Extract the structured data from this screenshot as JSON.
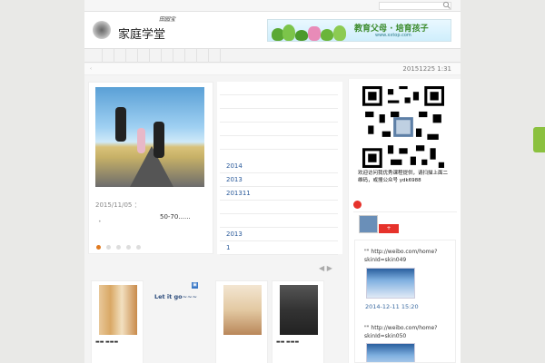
{
  "search": {
    "placeholder": ""
  },
  "header": {
    "logo_title": "家庭学堂",
    "logo_sub": "田园宝",
    "banner_title": "教育父母 · 培育孩子",
    "banner_url": "www.xxtop.com"
  },
  "dateline": {
    "datetime": "20151225 1:31"
  },
  "slider": {
    "date": "2015/11/05 ：",
    "caption": "50-70......",
    "dots": 5
  },
  "archive": {
    "items": [
      "",
      "",
      "",
      "",
      "",
      "2014",
      "2013",
      "201311",
      "",
      "",
      "2013",
      "1"
    ]
  },
  "sidebar": {
    "qr_text": "欢迎访问我优秀课程提供，请扫描上面二维码，或搜公众号 ydk6988",
    "follow_label": "+",
    "weibo_name": "",
    "posts": [
      {
        "text": "\"\" http://weibo.com/home?skinId=skin049",
        "date": "2014-12-11 15:20"
      },
      {
        "text": "\"\" http://weibo.com/home?skinId=skin050",
        "date": ""
      }
    ]
  },
  "books": {
    "second_title": "Let it go~~~"
  },
  "colors": {
    "accent": "#e07a20",
    "weibo": "#e6322b",
    "link": "#2a5a9a",
    "green_tab": "#8bc13f"
  }
}
